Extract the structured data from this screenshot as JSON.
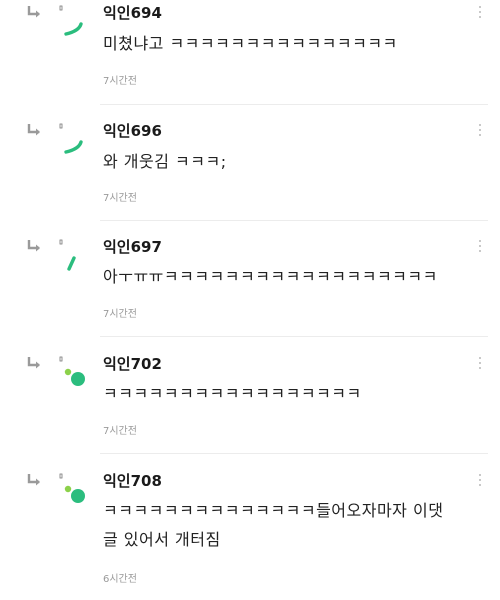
{
  "colors": {
    "accent": "#2bbd7e",
    "accent_light": "#8cd14a",
    "divider": "#ececec",
    "timestamp": "#9a9a9a"
  },
  "icons": {
    "reply": "reply-arrow-icon",
    "more": "more-vertical-icon"
  },
  "comments": [
    {
      "nickname": "익인694",
      "text": "미쳤냐고 ㅋㅋㅋㅋㅋㅋㅋㅋㅋㅋㅋㅋㅋㅋㅋ",
      "time": "7시간전",
      "avatar": "arc"
    },
    {
      "nickname": "익인696",
      "text": "와 개웃김 ㅋㅋㅋ;",
      "time": "7시간전",
      "avatar": "arc"
    },
    {
      "nickname": "익인697",
      "text": "아ㅜㅠㅠㅋㅋㅋㅋㅋㅋㅋㅋㅋㅋㅋㅋㅋㅋㅋㅋㅋㅋ",
      "time": "7시간전",
      "avatar": "bar"
    },
    {
      "nickname": "익인702",
      "text": "ㅋㅋㅋㅋㅋㅋㅋㅋㅋㅋㅋㅋㅋㅋㅋㅋㅋ",
      "time": "7시간전",
      "avatar": "dots"
    },
    {
      "nickname": "익인708",
      "text": "ㅋㅋㅋㅋㅋㅋㅋㅋㅋㅋㅋㅋㅋㅋ들어오자마자 이댓글 있어서 개터짐",
      "time": "6시간전",
      "avatar": "dots"
    }
  ]
}
